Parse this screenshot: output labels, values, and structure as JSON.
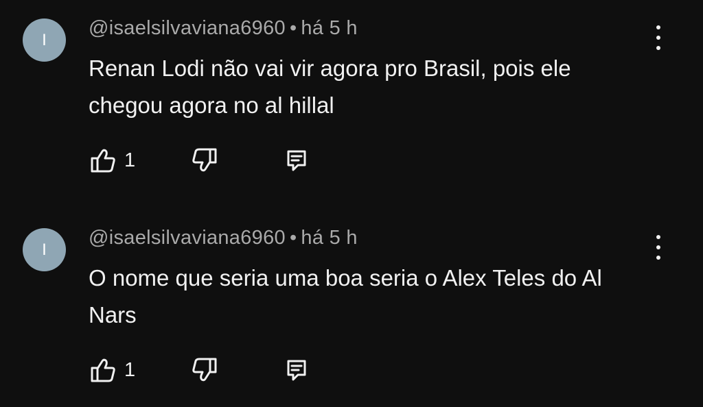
{
  "comments": [
    {
      "avatar_initial": "I",
      "author": "@isaelsilvaviana6960",
      "separator": "•",
      "time": "há 5 h",
      "text": "Renan Lodi não vai vir agora pro Brasil, pois ele chegou agora no al hillal",
      "likes": "1"
    },
    {
      "avatar_initial": "I",
      "author": "@isaelsilvaviana6960",
      "separator": "•",
      "time": "há 5 h",
      "text": "O nome que seria uma boa seria o Alex Teles do Al Nars",
      "likes": "1"
    }
  ],
  "icons": {
    "like": "thumbs-up-icon",
    "dislike": "thumbs-down-icon",
    "reply": "reply-comment-icon",
    "menu": "more-vertical-icon"
  },
  "colors": {
    "background": "#0f0f0f",
    "avatar": "#8fa6b4",
    "meta_text": "#aaaaaa",
    "body_text": "#f1f1f1"
  }
}
